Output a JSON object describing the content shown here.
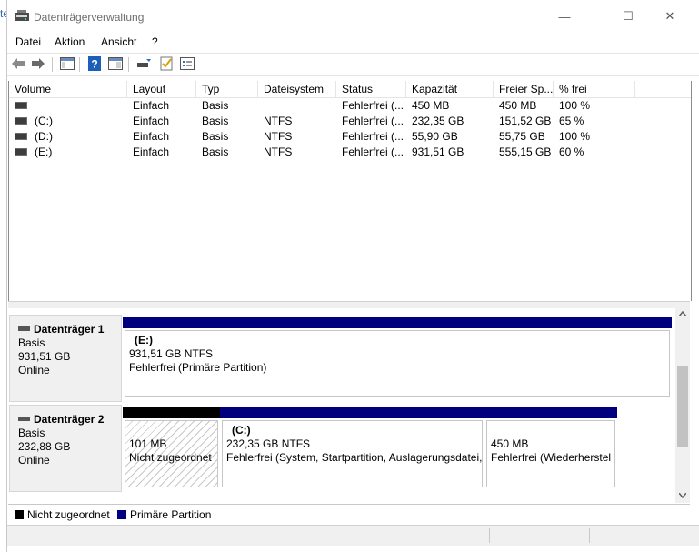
{
  "window": {
    "title": "Datenträgerverwaltung",
    "minimize_glyph": "—",
    "maximize_glyph": "☐",
    "close_glyph": "✕"
  },
  "bg": {
    "left_text": "te"
  },
  "menu": {
    "items": [
      "Datei",
      "Aktion",
      "Ansicht",
      "?"
    ]
  },
  "toolbar": {
    "icons": [
      "back-arrow-icon",
      "forward-arrow-icon",
      "console-tree-icon",
      "help-icon",
      "properties-icon",
      "connect-icon",
      "check-icon",
      "list-view-icon"
    ]
  },
  "list": {
    "headers": [
      "Volume",
      "Layout",
      "Typ",
      "Dateisystem",
      "Status",
      "Kapazität",
      "Freier Sp...",
      "% frei"
    ],
    "rows": [
      [
        "",
        "Einfach",
        "Basis",
        "",
        "Fehlerfrei (...",
        "450 MB",
        "450 MB",
        "100 %"
      ],
      [
        "(C:)",
        "Einfach",
        "Basis",
        "NTFS",
        "Fehlerfrei (...",
        "232,35 GB",
        "151,52 GB",
        "65 %"
      ],
      [
        "(D:)",
        "Einfach",
        "Basis",
        "NTFS",
        "Fehlerfrei (...",
        "55,90 GB",
        "55,75 GB",
        "100 %"
      ],
      [
        "(E:)",
        "Einfach",
        "Basis",
        "NTFS",
        "Fehlerfrei (...",
        "931,51 GB",
        "555,15 GB",
        "60 %"
      ]
    ]
  },
  "disks": [
    {
      "title": "Datenträger 1",
      "type": "Basis",
      "size": "931,51 GB",
      "state": "Online",
      "partitions": [
        {
          "name": "(E:)",
          "line1": "931,51 GB NTFS",
          "line2": "Fehlerfrei (Primäre Partition)"
        }
      ]
    },
    {
      "title": "Datenträger 2",
      "type": "Basis",
      "size": "232,88 GB",
      "state": "Online",
      "partitions": [
        {
          "name": "",
          "line1": "101 MB",
          "line2": "Nicht zugeordnet"
        },
        {
          "name": "(C:)",
          "line1": "232,35 GB NTFS",
          "line2": "Fehlerfrei (System, Startpartition, Auslagerungsdatei,"
        },
        {
          "name": "",
          "line1": "450 MB",
          "line2": "Fehlerfrei (Wiederherstel"
        }
      ]
    }
  ],
  "legend": {
    "unallocated": "Nicht zugeordnet",
    "primary": "Primäre Partition"
  },
  "colors": {
    "primary_bar": "#00007f",
    "unallocated_bar": "#000000"
  }
}
